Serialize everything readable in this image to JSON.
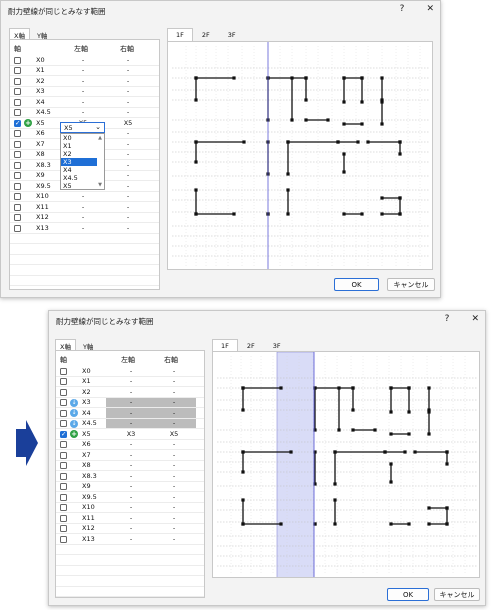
{
  "dialog_title": "耐力壁線が同じとみなす範囲",
  "help": "?",
  "close": "✕",
  "left_tabs": [
    "X軸",
    "Y軸"
  ],
  "headers": {
    "axis": "軸",
    "left": "左軸",
    "right": "右軸"
  },
  "floor_tabs": [
    "1F",
    "2F",
    "3F"
  ],
  "ok": "OK",
  "cancel": "キャンセル",
  "top_rows": [
    {
      "label": "X0",
      "left": "-",
      "right": "-"
    },
    {
      "label": "X1",
      "left": "-",
      "right": "-"
    },
    {
      "label": "X2",
      "left": "-",
      "right": "-"
    },
    {
      "label": "X3",
      "left": "-",
      "right": "-"
    },
    {
      "label": "X4",
      "left": "-",
      "right": "-"
    },
    {
      "label": "X4.5",
      "left": "-",
      "right": "-"
    },
    {
      "label": "X5",
      "left": "X5",
      "right": "X5",
      "checked": true
    },
    {
      "label": "X6",
      "left": "",
      "right": "-"
    },
    {
      "label": "X7",
      "left": "",
      "right": "-"
    },
    {
      "label": "X8",
      "left": "",
      "right": "-"
    },
    {
      "label": "X8.3",
      "left": "",
      "right": "-"
    },
    {
      "label": "X9",
      "left": "",
      "right": "-"
    },
    {
      "label": "X9.5",
      "left": "",
      "right": "-"
    },
    {
      "label": "X10",
      "left": "-",
      "right": "-"
    },
    {
      "label": "X11",
      "left": "-",
      "right": "-"
    },
    {
      "label": "X12",
      "left": "-",
      "right": "-"
    },
    {
      "label": "X13",
      "left": "-",
      "right": "-"
    }
  ],
  "dropdown_options": [
    "X0",
    "X1",
    "X2",
    "X3",
    "X4",
    "X4.5",
    "X5"
  ],
  "dropdown_selected": "X3",
  "bottom_rows": [
    {
      "label": "X0",
      "left": "-",
      "right": "-"
    },
    {
      "label": "X1",
      "left": "-",
      "right": "-"
    },
    {
      "label": "X2",
      "left": "-",
      "right": "-"
    },
    {
      "label": "X3",
      "left": "-",
      "right": "-"
    },
    {
      "label": "X4",
      "left": "-",
      "right": "-"
    },
    {
      "label": "X4.5",
      "left": "-",
      "right": "-"
    },
    {
      "label": "X5",
      "left": "X3",
      "right": "X5"
    },
    {
      "label": "X6",
      "left": "-",
      "right": "-"
    },
    {
      "label": "X7",
      "left": "-",
      "right": "-"
    },
    {
      "label": "X8",
      "left": "-",
      "right": "-"
    },
    {
      "label": "X8.3",
      "left": "-",
      "right": "-"
    },
    {
      "label": "X9",
      "left": "-",
      "right": "-"
    },
    {
      "label": "X9.5",
      "left": "-",
      "right": "-"
    },
    {
      "label": "X10",
      "left": "-",
      "right": "-"
    },
    {
      "label": "X11",
      "left": "-",
      "right": "-"
    },
    {
      "label": "X12",
      "left": "-",
      "right": "-"
    },
    {
      "label": "X13",
      "left": "-",
      "right": "-"
    }
  ],
  "colors": {
    "accent": "#1f6fd6",
    "arrow": "#1a3f9a",
    "highlight": "#d9dcf7",
    "axis_line": "#5a5ad6"
  }
}
